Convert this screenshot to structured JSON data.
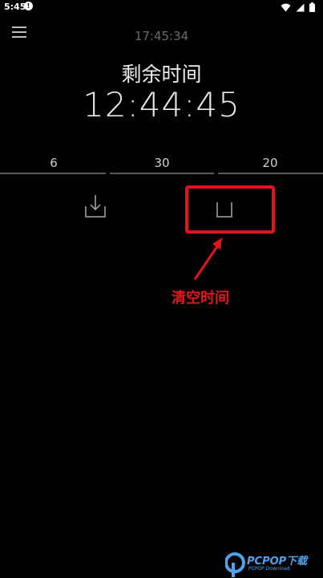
{
  "status_bar": {
    "time": "5:45",
    "app_icon": "notification-icon",
    "icons": [
      "wifi-icon",
      "signal-icon",
      "battery-icon"
    ]
  },
  "header": {
    "menu_icon": "menu-icon",
    "current_time": "17:45:34"
  },
  "timer": {
    "remaining_label": "剩余时间",
    "remaining_value": "12:44:45"
  },
  "picker": {
    "hours": "6",
    "minutes": "30",
    "seconds": "20"
  },
  "actions": {
    "save_icon": "download-icon",
    "clear_icon": "clear-icon"
  },
  "annotation": {
    "label": "清空时间",
    "color": "#e4141b"
  },
  "watermark": {
    "text": "PCPOP下载",
    "subtext": "PCPOP Download"
  }
}
